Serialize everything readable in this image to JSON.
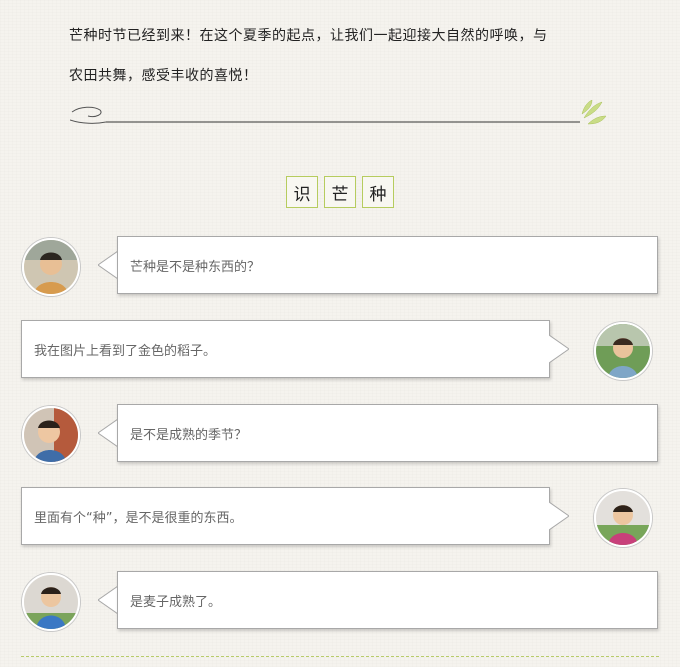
{
  "intro": {
    "line1": "芒种时节已经到来！在这个夏季的起点，让我们一起迎接大自然的呼唤，与",
    "line2": "农田共舞，感受丰收的喜悦！"
  },
  "section_title": [
    "识",
    "芒",
    "种"
  ],
  "colors": {
    "accent_green": "#b6cc5e",
    "bubble_border": "#a8a8a8",
    "text_gray": "#666666"
  },
  "messages": [
    {
      "side": "left",
      "text": "芒种是不是种东西的？",
      "avatar": "child-photo-avatar"
    },
    {
      "side": "right",
      "text": "我在图片上看到了金色的稻子。",
      "avatar": "child-photo-avatar"
    },
    {
      "side": "left",
      "text": "是不是成熟的季节？",
      "avatar": "child-photo-avatar"
    },
    {
      "side": "right",
      "text": "里面有个“种”，是不是很重的东西。",
      "avatar": "child-photo-avatar"
    },
    {
      "side": "left",
      "text": "是麦子成熟了。",
      "avatar": "child-photo-avatar"
    }
  ]
}
